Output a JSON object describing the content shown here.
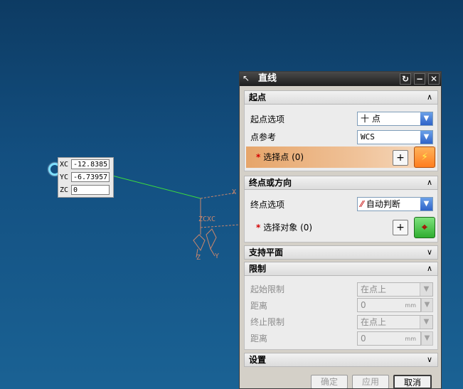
{
  "viewport": {
    "coords": [
      {
        "label": "XC",
        "value": "-12.8385"
      },
      {
        "label": "YC",
        "value": "-6.73957"
      },
      {
        "label": "ZC",
        "value": "0"
      }
    ],
    "axis_labels": {
      "x": "X",
      "zc": "ZC",
      "xc": "XC",
      "z": "Z",
      "y": "Y"
    }
  },
  "dialog": {
    "title": "直线",
    "start": {
      "header": "起点",
      "option_label": "起点选项",
      "option_value": "十 点",
      "ref_label": "点参考",
      "ref_value": "WCS",
      "select_label": "选择点 (0)"
    },
    "end": {
      "header": "终点或方向",
      "option_label": "终点选项",
      "option_value": "自动判断",
      "select_label": "选择对象 (0)"
    },
    "support": {
      "header": "支持平面"
    },
    "limits": {
      "header": "限制",
      "start_limit_label": "起始限制",
      "start_limit_value": "在点上",
      "start_dist_label": "距离",
      "start_dist_value": "0",
      "end_limit_label": "终止限制",
      "end_limit_value": "在点上",
      "end_dist_label": "距离",
      "end_dist_value": "0",
      "unit": "mm"
    },
    "settings": {
      "header": "设置"
    },
    "buttons": {
      "ok": "确定",
      "apply": "应用",
      "cancel": "取消"
    }
  },
  "colors": {
    "accent_orange": "#e6a56a",
    "title_bar": "#1e1e1e",
    "rubber_band": "#3ddc3d"
  }
}
